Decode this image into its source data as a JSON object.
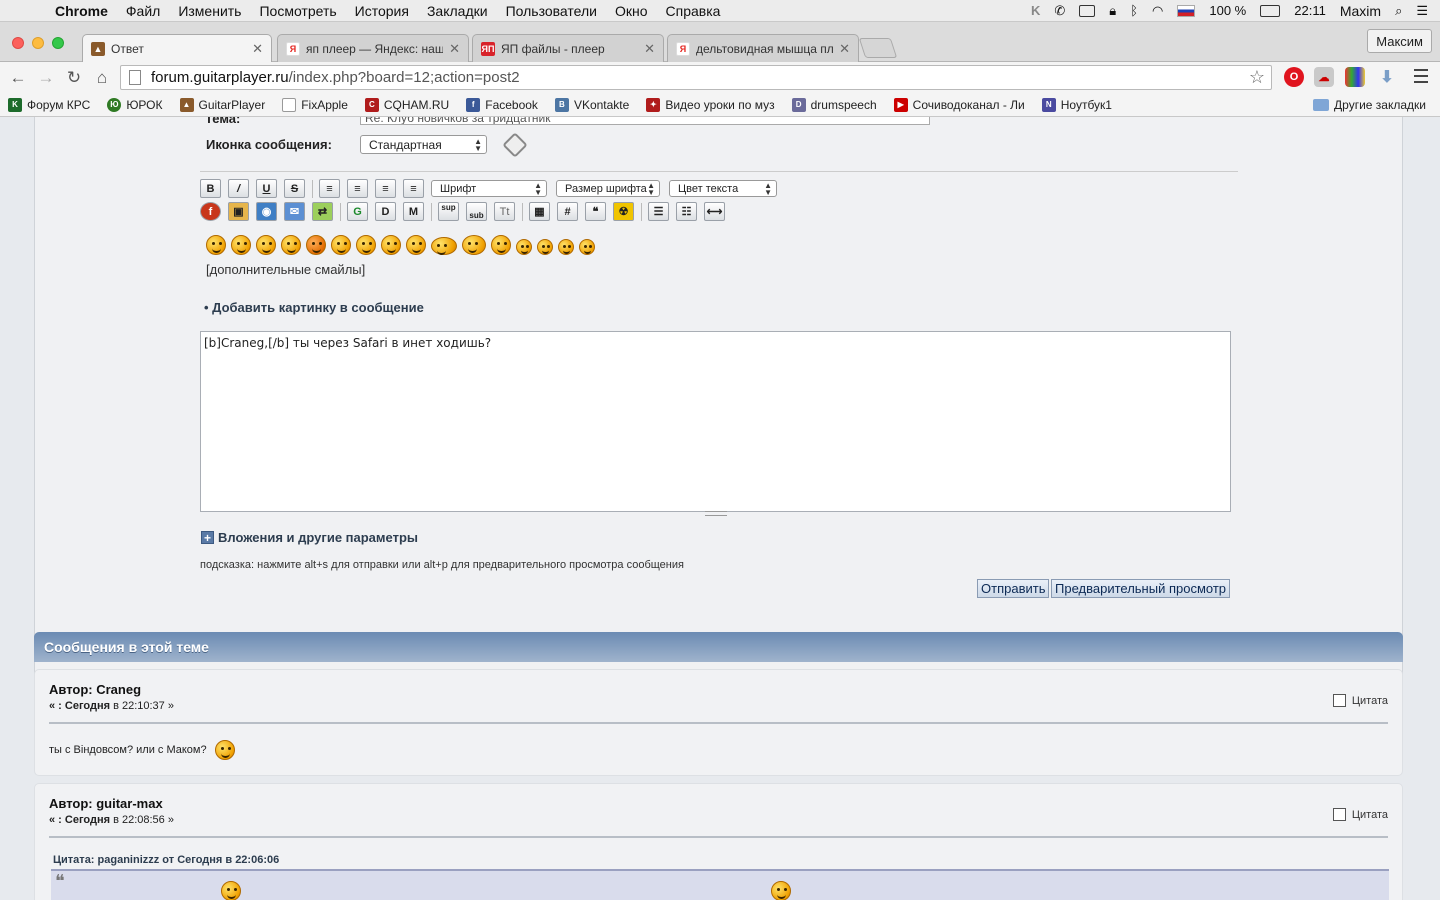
{
  "menubar": {
    "app": "Chrome",
    "items": [
      "Файл",
      "Изменить",
      "Посмотреть",
      "История",
      "Закладки",
      "Пользователи",
      "Окно",
      "Справка"
    ],
    "battery": "100 %",
    "time": "22:11",
    "user": "Maxim"
  },
  "tabs": [
    {
      "title": "Ответ",
      "active": true,
      "color": "#8a5a2b"
    },
    {
      "title": "яп плеер — Яндекс: нашл",
      "active": false,
      "color": "#e52620"
    },
    {
      "title": "ЯП файлы - плеер",
      "active": false,
      "color": "#d8232a"
    },
    {
      "title": "дельтовидная мышца пле",
      "active": false,
      "color": "#e52620"
    }
  ],
  "profile": "Максим",
  "address": {
    "host": "forum.guitarplayer.ru",
    "path": "/index.php?board=12;action=post2"
  },
  "bookmarks": [
    {
      "label": "Форум КРС",
      "color": "#1d6b2b"
    },
    {
      "label": "ЮРОК",
      "color": "#2f7a24"
    },
    {
      "label": "GuitarPlayer",
      "color": "#8a5a2b"
    },
    {
      "label": "FixApple",
      "color": "#999999"
    },
    {
      "label": "CQHAM.RU",
      "color": "#b01c1c"
    },
    {
      "label": "Facebook",
      "color": "#3b5998"
    },
    {
      "label": "VKontakte",
      "color": "#4c75a3"
    },
    {
      "label": "Видео уроки по муз",
      "color": "#b01c1c"
    },
    {
      "label": "drumspeech",
      "color": "#6a6a9a"
    },
    {
      "label": "Сочиводоканал - Ли",
      "color": "#cc0000"
    },
    {
      "label": "Ноутбук1",
      "color": "#4a4aa0"
    }
  ],
  "bookmarks_other": "Другие закладки",
  "form": {
    "subject_label": "Тема:",
    "subject_value": "Re: Клуб новичков за тридцатник",
    "icon_label": "Иконка сообщения:",
    "icon_value": "Стандартная",
    "font_select": "Шрифт",
    "size_select": "Размер шрифта",
    "color_select": "Цвет текста",
    "btn_sup": "sup",
    "btn_sub": "sub",
    "btn_tt": "Tt",
    "more_smileys": "[дополнительные смайлы]",
    "add_image": "• Добавить картинку в сообщение",
    "message": "[b]Craneg,[/b] ты через Safari в инет ходишь?",
    "attachments": "Вложения и другие параметры",
    "hint": "подсказка: нажмите alt+s для отправки или alt+p для предварительного просмотра сообщения",
    "submit": "Отправить",
    "preview": "Предварительный просмотр"
  },
  "topic": {
    "header": "Сообщения в этой теме",
    "quote_label": "Цитата",
    "messages": [
      {
        "author": "Автор: Craneg",
        "date_prefix": "« : Сегодня",
        "date_rest": " в 22:10:37 »",
        "body": "ты с Віндовсом? или с Маком?"
      },
      {
        "author": "Автор: guitar-max",
        "date_prefix": "« : Сегодня",
        "date_rest": " в 22:08:56 »",
        "quote_head": "Цитата: paganinizzz от Сегодня в 22:06:06"
      }
    ]
  }
}
